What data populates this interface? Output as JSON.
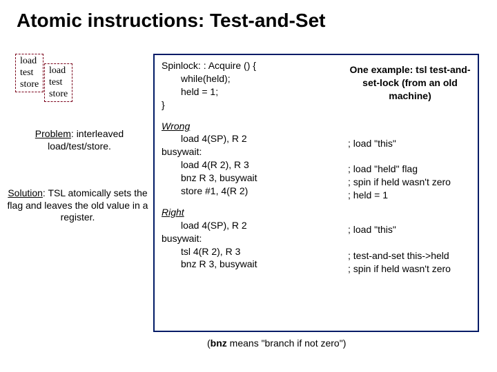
{
  "title": "Atomic instructions: Test-and-Set",
  "box1": {
    "l1": "load",
    "l2": "test",
    "l3": "store"
  },
  "box2": {
    "l1": "load",
    "l2": "test",
    "l3": "store"
  },
  "problem": {
    "head": "Problem",
    "tail": ": interleaved load/test/store."
  },
  "solution": {
    "head": "Solution",
    "tail": ": TSL atomically sets the flag and leaves the old value in a register."
  },
  "code": {
    "sig": "Spinlock: : Acquire () {",
    "l1": "while(held);",
    "l2": "held = 1;",
    "close": "}",
    "wrong": "Wrong",
    "w1": "load  4(SP), R 2",
    "bw": "busywait:",
    "w2": "load    4(R 2), R 3",
    "w3": "bnz   R 3, busywait",
    "w4": "store #1, 4(R 2)",
    "right": "Right",
    "r1": "load  4(SP), R 2",
    "r2": "tsl     4(R 2), R 3",
    "r3": "bnz   R 3, busywait"
  },
  "example": "One example: tsl test-and-set-lock (from an old machine)",
  "cm": {
    "c1": "; load \"this\"",
    "c2": "; load \"held\" flag",
    "c3": "; spin if held wasn't zero",
    "c4": "; held = 1",
    "c5": "; load \"this\"",
    "c6": "; test-and-set this->held",
    "c7": "; spin if held wasn't zero"
  },
  "foot": {
    "pre": "(",
    "bold": "bnz",
    "post": " means \"branch if not zero\")"
  }
}
